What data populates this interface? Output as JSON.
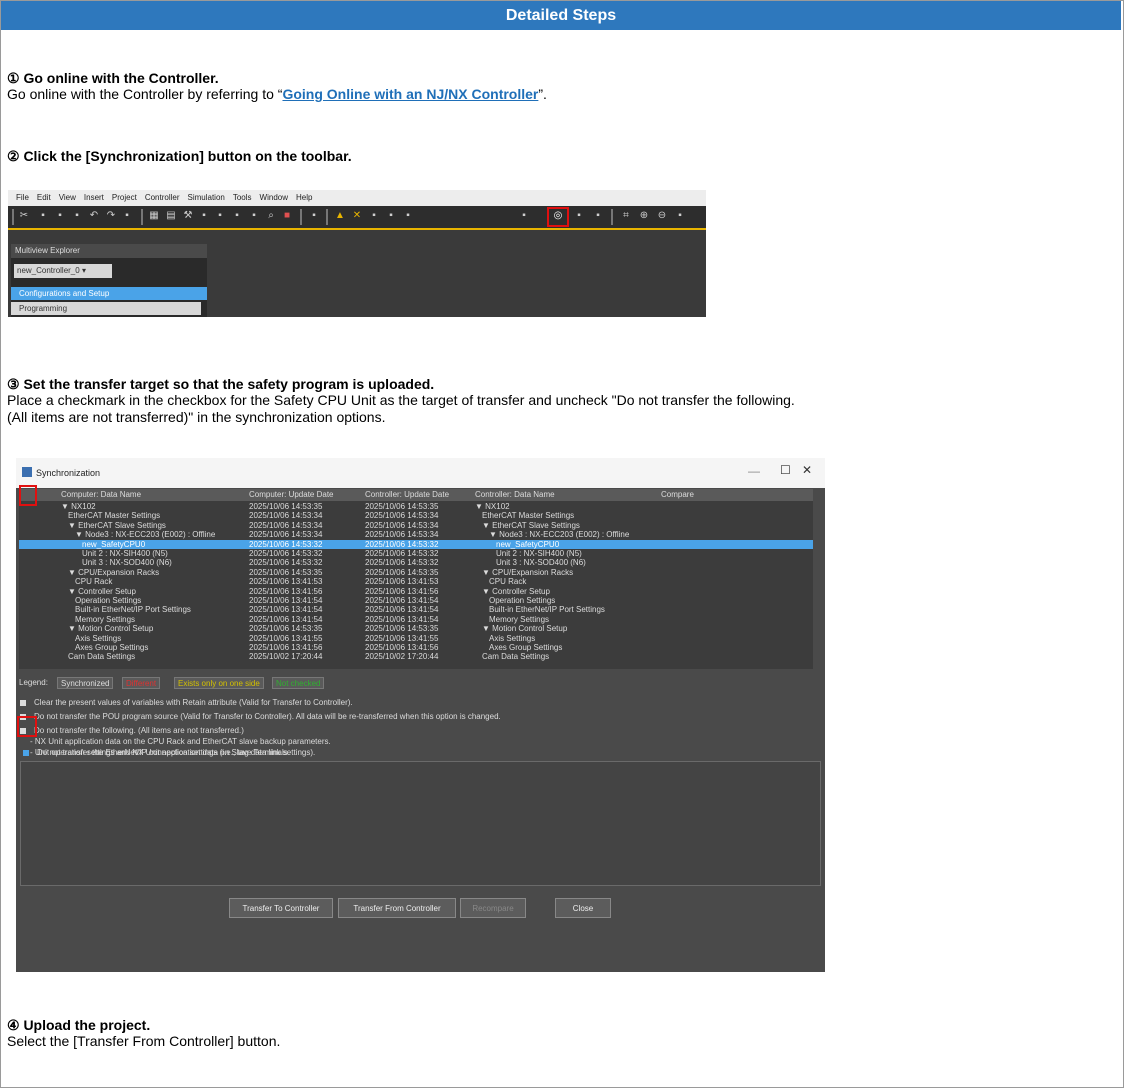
{
  "header": {
    "title": "Detailed Steps"
  },
  "step1": {
    "title": "① Go online with the Controller.",
    "text_before": "Go online with the Controller by referring to “",
    "link": "Going Online with an NJ/NX Controller",
    "text_after": "”."
  },
  "step2": {
    "title": "② Click the [Synchronization] button on the toolbar."
  },
  "toolbar_shot": {
    "menu": [
      "File",
      "Edit",
      "View",
      "Insert",
      "Project",
      "Controller",
      "Simulation",
      "Tools",
      "Window",
      "Help"
    ],
    "explorer_title": "Multiview Explorer",
    "controller_select": "new_Controller_0",
    "item_config": "Configurations and Setup",
    "item_programming": "Programming"
  },
  "step3": {
    "title": "③ Set the transfer target so that the safety program is uploaded.",
    "line1": "Place a checkmark in the checkbox for the Safety CPU Unit as the target of transfer and uncheck \"Do not transfer the following.",
    "line2": "(All items are not transferred)\" in the synchronization options."
  },
  "sync_dialog": {
    "title": "Synchronization",
    "columns": [
      "Computer: Data Name",
      "Computer: Update Date",
      "Controller: Update Date",
      "Controller: Data Name",
      "Compare"
    ],
    "rows": [
      {
        "name": "▼ NX102",
        "cdate": "2025/10/06 14:53:35",
        "kdate": "2025/10/06 14:53:35",
        "kname": "▼ NX102"
      },
      {
        "name": "EtherCAT Master Settings",
        "cdate": "2025/10/06 14:53:34",
        "kdate": "2025/10/06 14:53:34",
        "kname": "EtherCAT Master Settings"
      },
      {
        "name": "▼ EtherCAT Slave Settings",
        "cdate": "2025/10/06 14:53:34",
        "kdate": "2025/10/06 14:53:34",
        "kname": "▼ EtherCAT Slave Settings"
      },
      {
        "name": "▼ Node3 : NX-ECC203 (E002) : Offline",
        "cdate": "2025/10/06 14:53:34",
        "kdate": "2025/10/06 14:53:34",
        "kname": "▼ Node3 : NX-ECC203 (E002) : Offline"
      },
      {
        "name": "new_SafetyCPU0",
        "cdate": "2025/10/06 14:53:32",
        "kdate": "2025/10/06 14:53:32",
        "kname": "new_SafetyCPU0"
      },
      {
        "name": "Unit 2 : NX-SIH400 (N5)",
        "cdate": "2025/10/06 14:53:32",
        "kdate": "2025/10/06 14:53:32",
        "kname": "Unit 2 : NX-SIH400 (N5)"
      },
      {
        "name": "Unit 3 : NX-SOD400 (N6)",
        "cdate": "2025/10/06 14:53:32",
        "kdate": "2025/10/06 14:53:32",
        "kname": "Unit 3 : NX-SOD400 (N6)"
      },
      {
        "name": "▼ CPU/Expansion Racks",
        "cdate": "2025/10/06 14:53:35",
        "kdate": "2025/10/06 14:53:35",
        "kname": "▼ CPU/Expansion Racks"
      },
      {
        "name": "CPU Rack",
        "cdate": "2025/10/06 13:41:53",
        "kdate": "2025/10/06 13:41:53",
        "kname": "CPU Rack"
      },
      {
        "name": "▼ Controller Setup",
        "cdate": "2025/10/06 13:41:56",
        "kdate": "2025/10/06 13:41:56",
        "kname": "▼ Controller Setup"
      },
      {
        "name": "Operation Settings",
        "cdate": "2025/10/06 13:41:54",
        "kdate": "2025/10/06 13:41:54",
        "kname": "Operation Settings"
      },
      {
        "name": "Built-in EtherNet/IP Port Settings",
        "cdate": "2025/10/06 13:41:54",
        "kdate": "2025/10/06 13:41:54",
        "kname": "Built-in EtherNet/IP Port Settings"
      },
      {
        "name": "Memory Settings",
        "cdate": "2025/10/06 13:41:54",
        "kdate": "2025/10/06 13:41:54",
        "kname": "Memory Settings"
      },
      {
        "name": "▼ Motion Control Setup",
        "cdate": "2025/10/06 14:53:35",
        "kdate": "2025/10/06 14:53:35",
        "kname": "▼ Motion Control Setup"
      },
      {
        "name": "Axis Settings",
        "cdate": "2025/10/06 13:41:55",
        "kdate": "2025/10/06 13:41:55",
        "kname": "Axis Settings"
      },
      {
        "name": "Axes Group Settings",
        "cdate": "2025/10/06 13:41:56",
        "kdate": "2025/10/06 13:41:56",
        "kname": "Axes Group Settings"
      },
      {
        "name": "Cam Data Settings",
        "cdate": "2025/10/02 17:20:44",
        "kdate": "2025/10/02 17:20:44",
        "kname": "Cam Data Settings"
      }
    ],
    "legend_label": "Legend:",
    "legend_sync": "Synchronized",
    "legend_diff": "Different",
    "legend_one": "Exists only on one side",
    "legend_nc": "Not checked",
    "opt1": "Clear the present values of variables with Retain attribute (Valid for Transfer to Controller).",
    "opt2": "Do not transfer the POU program source (Valid for Transfer to Controller). All data will be re-transferred when this option is changed.",
    "opt3": "Do not transfer the following. (All items are not transferred.)",
    "opt3a": "- NX Unit application data on the CPU Rack and EtherCAT slave backup parameters.",
    "opt3b": "- Unit operation settings and NX Unit application data on Slave Terminals.",
    "opt4": "Do not transfer the EtherNet/IP connection settings (i.e., tag data link settings).",
    "btn_to": "Transfer To Controller",
    "btn_from": "Transfer From Controller",
    "btn_recompare": "Recompare",
    "btn_close": "Close"
  },
  "step4": {
    "title": "④ Upload the project.",
    "text": "Select the [Transfer From Controller] button."
  }
}
